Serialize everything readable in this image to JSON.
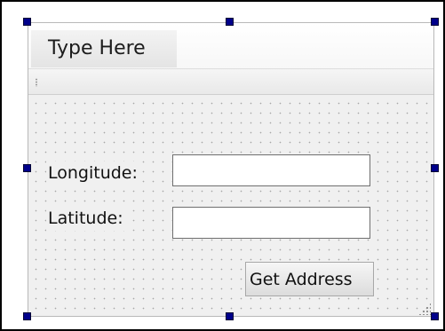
{
  "menubar": {
    "placeholder_label": "Type Here"
  },
  "form": {
    "longitude_label": "Longitude:",
    "longitude_value": "",
    "latitude_label": "Latitude:",
    "latitude_value": "",
    "get_address_label": "Get Address"
  },
  "selection": {
    "handle_color": "#00008b",
    "handles": [
      "top-left",
      "top-center",
      "top-right",
      "middle-left",
      "middle-right",
      "bottom-left",
      "bottom-center",
      "bottom-right"
    ]
  },
  "icons": [
    "toolbar-grip-icon",
    "size-grip-icon"
  ]
}
